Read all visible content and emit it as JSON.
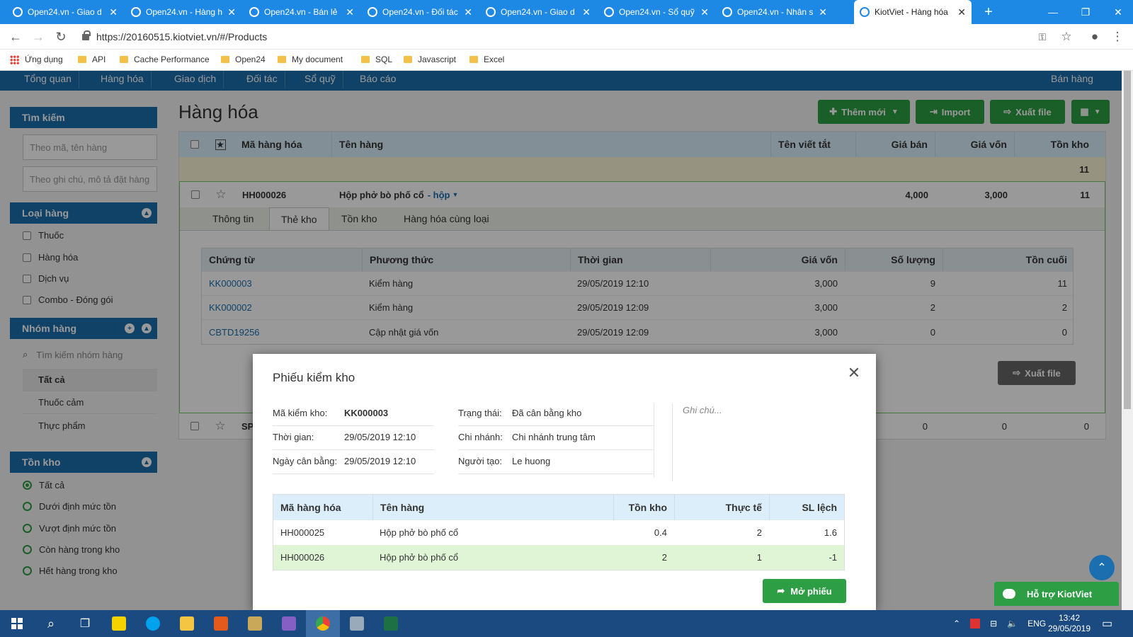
{
  "browser": {
    "tabs": [
      {
        "title": "Open24.vn - Giao d"
      },
      {
        "title": "Open24.vn - Hàng h"
      },
      {
        "title": "Open24.vn - Bán lẻ"
      },
      {
        "title": "Open24.vn - Đối tác"
      },
      {
        "title": "Open24.vn - Giao d"
      },
      {
        "title": "Open24.vn - Sổ quỹ"
      },
      {
        "title": "Open24.vn - Nhân s"
      },
      {
        "title": "KiotViet - Hàng hóa"
      }
    ],
    "url": "https://20160515.kiotviet.vn/#/Products",
    "bookmarks": [
      "Ứng dụng",
      "API",
      "Cache Performance",
      "Open24",
      "My document",
      "SQL",
      "Javascript",
      "Excel"
    ]
  },
  "topnav": {
    "items": [
      "Tổng quan",
      "Hàng hóa",
      "Giao dịch",
      "Đối tác",
      "Sổ quỹ",
      "Báo cáo"
    ],
    "sell": "Bán hàng"
  },
  "sidebar": {
    "search_title": "Tìm kiếm",
    "search_ph1": "Theo mã, tên hàng",
    "search_ph2": "Theo ghi chú, mô tả đặt hàng",
    "type_title": "Loại hàng",
    "types": [
      "Thuốc",
      "Hàng hóa",
      "Dịch vụ",
      "Combo - Đóng gói"
    ],
    "group_title": "Nhóm hàng",
    "group_search": "Tìm kiếm nhóm hàng",
    "groups": [
      "Tất cả",
      "Thuốc cảm",
      "Thực phẩm"
    ],
    "stock_title": "Tồn kho",
    "stock_opts": [
      "Tất cả",
      "Dưới định mức tồn",
      "Vượt định mức tồn",
      "Còn hàng trong kho",
      "Hết hàng trong kho"
    ]
  },
  "page": {
    "title": "Hàng hóa",
    "btn_add": "Thêm mới",
    "btn_import": "Import",
    "btn_export": "Xuất file"
  },
  "grid": {
    "headers": [
      "Mã hàng hóa",
      "Tên hàng",
      "Tên viết tắt",
      "Giá bán",
      "Giá vốn",
      "Tồn kho"
    ],
    "sum_stock": "11",
    "product": {
      "code": "HH000026",
      "name": "Hộp phở bò phố cổ",
      "unit": "- hộp",
      "price": "4,000",
      "cost": "3,000",
      "stock": "11"
    },
    "row2": {
      "code": "SP",
      "price": "0",
      "cost": "0",
      "stock": "0"
    },
    "detail_tabs": [
      "Thông tin",
      "Thẻ kho",
      "Tồn kho",
      "Hàng hóa cùng loại"
    ],
    "ledger_headers": [
      "Chứng từ",
      "Phương thức",
      "Thời gian",
      "Giá vốn",
      "Số lượng",
      "Tồn cuối"
    ],
    "ledger_rows": [
      [
        "KK000003",
        "Kiểm hàng",
        "29/05/2019 12:10",
        "3,000",
        "9",
        "11"
      ],
      [
        "KK000002",
        "Kiểm hàng",
        "29/05/2019 12:09",
        "3,000",
        "2",
        "2"
      ],
      [
        "CBTD19256",
        "Cập nhật giá vốn",
        "29/05/2019 12:09",
        "3,000",
        "0",
        "0"
      ]
    ],
    "ledger_export": "Xuất file"
  },
  "modal": {
    "title": "Phiếu kiểm kho",
    "code_label": "Mã kiểm kho:",
    "code": "KK000003",
    "time_label": "Thời gian:",
    "time": "29/05/2019 12:10",
    "balance_label": "Ngày cân bằng:",
    "balance": "29/05/2019 12:10",
    "status_label": "Trạng thái:",
    "status": "Đã cân bằng kho",
    "branch_label": "Chi nhánh:",
    "branch": "Chi nhánh trung tâm",
    "creator_label": "Người tạo:",
    "creator": "Le huong",
    "note_ph": "Ghi chú...",
    "headers": [
      "Mã hàng hóa",
      "Tên hàng",
      "Tồn kho",
      "Thực tế",
      "SL lệch"
    ],
    "rows": [
      [
        "HH000025",
        "Hộp phở bò phố cổ",
        "0.4",
        "2",
        "1.6"
      ],
      [
        "HH000026",
        "Hộp phở bò phố cổ",
        "2",
        "1",
        "-1"
      ]
    ],
    "open_btn": "Mở phiếu"
  },
  "support": "Hỗ trợ KiotViet",
  "taskbar": {
    "lang": "ENG",
    "time": "13:42",
    "date": "29/05/2019"
  },
  "colors": {
    "primary": "#1b6fae",
    "success": "#2e9e44",
    "chrome": "#1e88e5"
  }
}
